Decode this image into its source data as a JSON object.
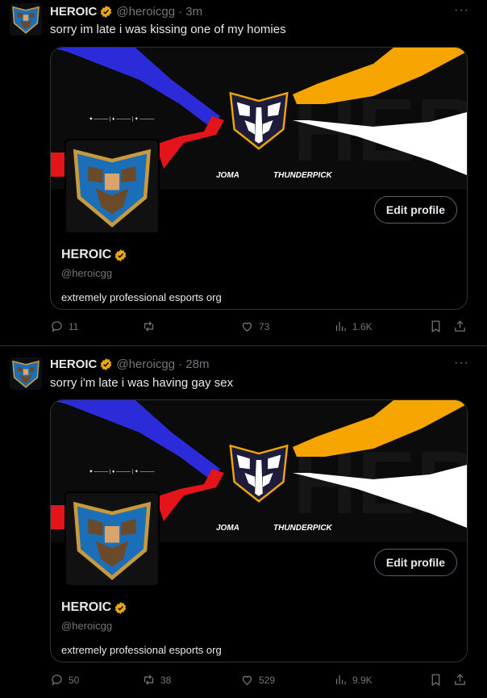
{
  "tweets": [
    {
      "name": "HEROIC",
      "handle": "@heroicgg",
      "time": "· 3m",
      "more": "···",
      "text": "sorry im late i was kissing one of my homies",
      "card": {
        "name": "HEROIC",
        "handle": "@heroicgg",
        "bio": "extremely professional esports org",
        "edit_label": "Edit profile",
        "sponsor1": "JOMA",
        "sponsor2": "THUNDERPICK"
      },
      "stats": {
        "replies": "11",
        "retweets": "",
        "likes": "73",
        "views": "1.6K"
      }
    },
    {
      "name": "HEROIC",
      "handle": "@heroicgg",
      "time": "· 28m",
      "more": "···",
      "text": "sorry i'm late i was having gay sex",
      "card": {
        "name": "HEROIC",
        "handle": "@heroicgg",
        "bio": "extremely professional esports org",
        "edit_label": "Edit profile",
        "sponsor1": "JOMA",
        "sponsor2": "THUNDERPICK"
      },
      "stats": {
        "replies": "50",
        "retweets": "38",
        "likes": "529",
        "views": "9.9K"
      }
    }
  ],
  "colors": {
    "accent_blue": "#2b2bd9",
    "accent_orange": "#f5a400",
    "accent_red": "#e4141b",
    "verified": "#e8a811",
    "muted": "#71767b"
  }
}
